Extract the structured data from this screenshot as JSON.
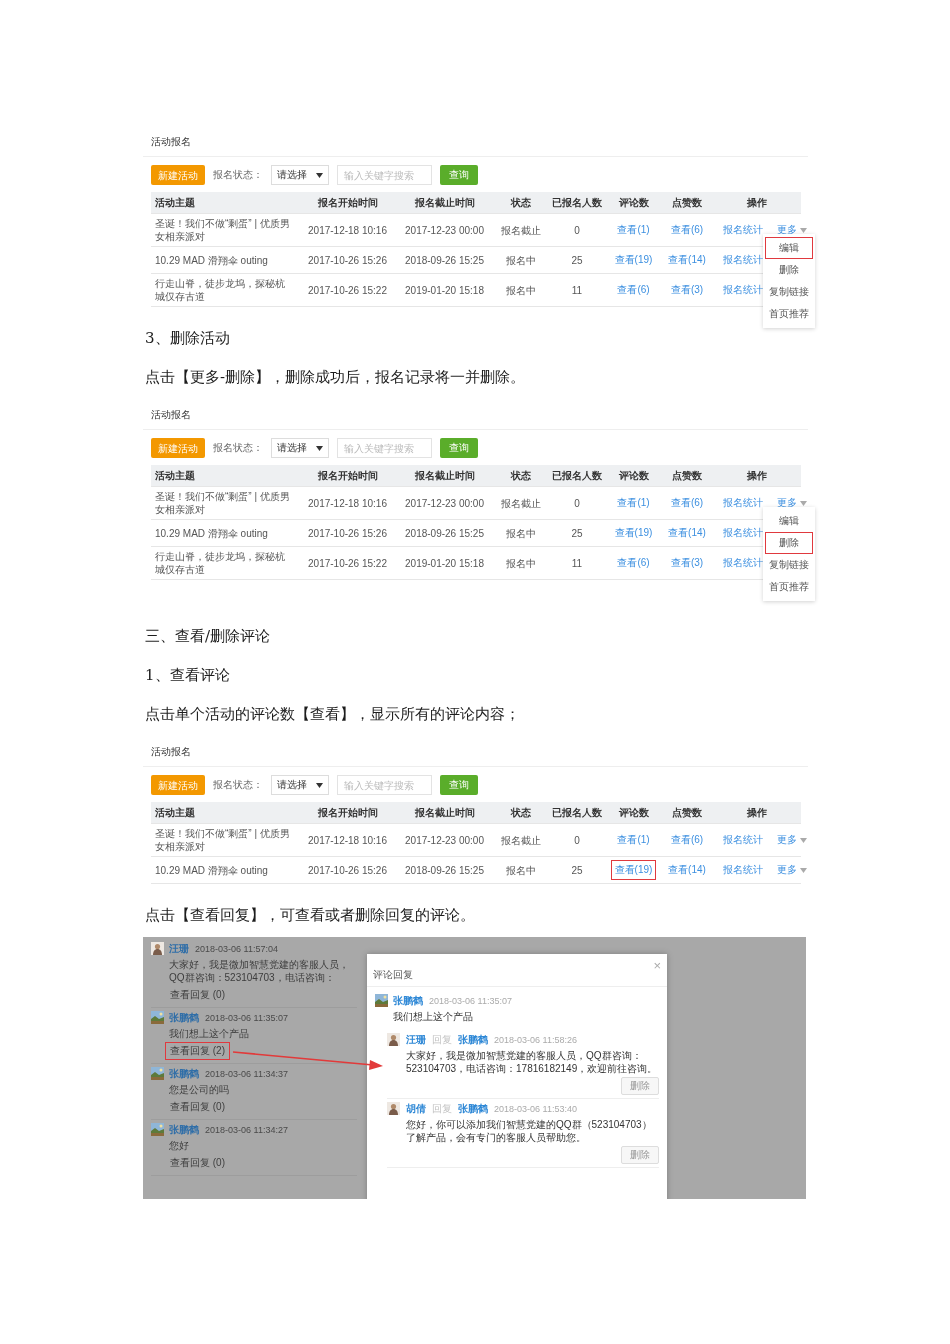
{
  "blocks": [
    {
      "kind": "table_panel",
      "title": "活动报名",
      "new_button": "新建活动",
      "status_label": "报名状态：",
      "select": "请选择",
      "search_placeholder": "输入关键字搜索",
      "query_button": "查询",
      "columns": [
        "活动主题",
        "报名开始时间",
        "报名截止时间",
        "状态",
        "已报名人数",
        "评论数",
        "点赞数",
        "操作"
      ],
      "rows": [
        {
          "topic": "圣诞！我们不做“剩蛋” | 优质男女相亲派对",
          "start": "2017-12-18 10:16",
          "end": "2017-12-23 00:00",
          "status": "报名截止",
          "count": "0",
          "comments": {
            "label": "查看(1)",
            "highlighted": false
          },
          "likes": "查看(6)",
          "stats": "报名统计",
          "more": "更多"
        },
        {
          "topic": "10.29 MAD 滑翔伞 outing",
          "start": "2017-10-26 15:26",
          "end": "2018-09-26 15:25",
          "status": "报名中",
          "count": "25",
          "comments": {
            "label": "查看(19)",
            "highlighted": false
          },
          "likes": "查看(14)",
          "stats": "报名统计"
        },
        {
          "topic": "行走山脊，徒步龙坞，探秘杭城仅存古道",
          "start": "2017-10-26 15:22",
          "end": "2019-01-20 15:18",
          "status": "报名中",
          "count": "11",
          "comments": {
            "label": "查看(6)",
            "highlighted": false
          },
          "likes": "查看(3)",
          "stats": "报名统计"
        }
      ],
      "menu": [
        {
          "label": "编辑",
          "selected": true
        },
        {
          "label": "删除",
          "selected": false
        },
        {
          "label": "复制链接",
          "selected": false
        },
        {
          "label": "首页推荐",
          "selected": false
        }
      ]
    },
    {
      "kind": "paragraph",
      "text": "3、删除活动"
    },
    {
      "kind": "paragraph",
      "text": "点击【更多-删除】，删除成功后，报名记录将一并删除。"
    },
    {
      "kind": "table_panel",
      "title": "活动报名",
      "new_button": "新建活动",
      "status_label": "报名状态：",
      "select": "请选择",
      "search_placeholder": "输入关键字搜索",
      "query_button": "查询",
      "columns": [
        "活动主题",
        "报名开始时间",
        "报名截止时间",
        "状态",
        "已报名人数",
        "评论数",
        "点赞数",
        "操作"
      ],
      "rows": [
        {
          "topic": "圣诞！我们不做“剩蛋” | 优质男女相亲派对",
          "start": "2017-12-18 10:16",
          "end": "2017-12-23 00:00",
          "status": "报名截止",
          "count": "0",
          "comments": {
            "label": "查看(1)",
            "highlighted": false
          },
          "likes": "查看(6)",
          "stats": "报名统计",
          "more": "更多"
        },
        {
          "topic": "10.29 MAD 滑翔伞 outing",
          "start": "2017-10-26 15:26",
          "end": "2018-09-26 15:25",
          "status": "报名中",
          "count": "25",
          "comments": {
            "label": "查看(19)",
            "highlighted": false
          },
          "likes": "查看(14)",
          "stats": "报名统计"
        },
        {
          "topic": "行走山脊，徒步龙坞，探秘杭城仅存古道",
          "start": "2017-10-26 15:22",
          "end": "2019-01-20 15:18",
          "status": "报名中",
          "count": "11",
          "comments": {
            "label": "查看(6)",
            "highlighted": false
          },
          "likes": "查看(3)",
          "stats": "报名统计"
        }
      ],
      "menu": [
        {
          "label": "编辑",
          "selected": false
        },
        {
          "label": "删除",
          "selected": true
        },
        {
          "label": "复制链接",
          "selected": false
        },
        {
          "label": "首页推荐",
          "selected": false
        }
      ]
    },
    {
      "kind": "section_heading",
      "text": "三、查看/删除评论"
    },
    {
      "kind": "paragraph",
      "text": "1、查看评论"
    },
    {
      "kind": "paragraph",
      "text": "点击单个活动的评论数【查看】，显示所有的评论内容；"
    },
    {
      "kind": "table_panel",
      "title": "活动报名",
      "new_button": "新建活动",
      "status_label": "报名状态：",
      "select": "请选择",
      "search_placeholder": "输入关键字搜索",
      "query_button": "查询",
      "columns": [
        "活动主题",
        "报名开始时间",
        "报名截止时间",
        "状态",
        "已报名人数",
        "评论数",
        "点赞数",
        "操作"
      ],
      "rows": [
        {
          "topic": "圣诞！我们不做“剩蛋” | 优质男女相亲派对",
          "start": "2017-12-18 10:16",
          "end": "2017-12-23 00:00",
          "status": "报名截止",
          "count": "0",
          "comments": {
            "label": "查看(1)",
            "highlighted": false
          },
          "likes": "查看(6)",
          "stats": "报名统计",
          "more": "更多"
        },
        {
          "topic": "10.29 MAD 滑翔伞 outing",
          "start": "2017-10-26 15:26",
          "end": "2018-09-26 15:25",
          "status": "报名中",
          "count": "25",
          "comments": {
            "label": "查看(19)",
            "highlighted": true
          },
          "likes": "查看(14)",
          "stats": "报名统计",
          "more": "更多"
        }
      ]
    },
    {
      "kind": "paragraph",
      "text": "点击【查看回复】，可查看或者删除回复的评论。"
    },
    {
      "kind": "comments_screen",
      "comments": [
        {
          "name": "汪珊",
          "time": "2018-03-06 11:57:04",
          "text": "大家好，我是微加智慧党建的客服人员，QQ群咨询：523104703，电话咨询：",
          "replies_link": "查看回复 (0)",
          "highlighted": false
        },
        {
          "name": "张鹏鹤",
          "time": "2018-03-06 11:35:07",
          "text": "我们想上这个产品",
          "replies_link": "查看回复 (2)",
          "highlighted": true
        },
        {
          "name": "张鹏鹤",
          "time": "2018-03-06 11:34:37",
          "text": "您是公司的吗",
          "replies_link": "查看回复 (0)",
          "highlighted": false
        },
        {
          "name": "张鹏鹤",
          "time": "2018-03-06 11:34:27",
          "text": "您好",
          "replies_link": "查看回复 (0)",
          "highlighted": false
        }
      ],
      "dialog": {
        "title": "评论回复",
        "close": "×",
        "comment": {
          "name": "张鹏鹤",
          "time": "2018-03-06 11:35:07",
          "text": "我们想上这个产品"
        },
        "replies": [
          {
            "name": "汪珊",
            "reply_word": "回复",
            "target": "张鹏鹤",
            "time": "2018-03-06 11:58:26",
            "text": "大家好，我是微加智慧党建的客服人员，QQ群咨询：523104703，电话咨询：17816182149，欢迎前往咨询。",
            "delete": "删除"
          },
          {
            "name": "胡倩",
            "reply_word": "回复",
            "target": "张鹏鹤",
            "time": "2018-03-06 11:53:40",
            "text": "您好，你可以添加我们智慧党建的QQ群（523104703）了解产品，会有专门的客服人员帮助您。",
            "delete": "删除"
          }
        ]
      }
    }
  ]
}
